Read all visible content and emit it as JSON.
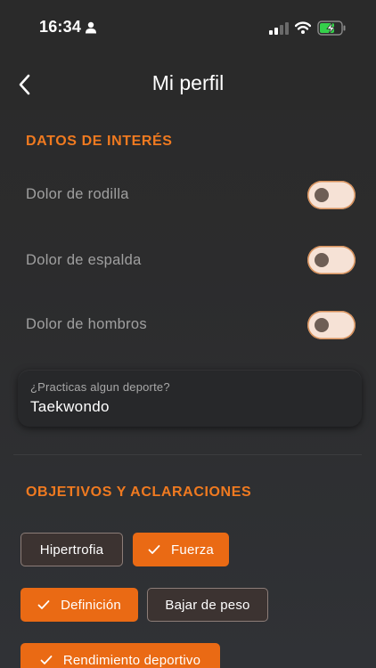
{
  "status_bar": {
    "time": "16:34",
    "icons": [
      "person-icon",
      "signal-icon",
      "wifi-icon",
      "battery-charging-icon"
    ]
  },
  "header": {
    "title": "Mi perfil",
    "back_icon": "chevron-left-icon"
  },
  "datos": {
    "title": "DATOS DE INTERÉS",
    "toggles": [
      {
        "label": "Dolor de rodilla",
        "on": false
      },
      {
        "label": "Dolor de espalda",
        "on": false
      },
      {
        "label": "Dolor de hombros",
        "on": false
      }
    ],
    "sport": {
      "label": "¿Practicas algun deporte?",
      "value": "Taekwondo"
    }
  },
  "objetivos": {
    "title": "OBJETIVOS Y ACLARACIONES",
    "chips": [
      {
        "label": "Hipertrofia",
        "selected": false
      },
      {
        "label": "Fuerza",
        "selected": true
      },
      {
        "label": "Definición",
        "selected": true
      },
      {
        "label": "Bajar de peso",
        "selected": false
      },
      {
        "label": "Rendimiento deportivo",
        "selected": true
      }
    ]
  },
  "colors": {
    "accent": "#f07a20",
    "chip_selected": "#ea6a14",
    "toggle_track": "#f6e2d6"
  }
}
